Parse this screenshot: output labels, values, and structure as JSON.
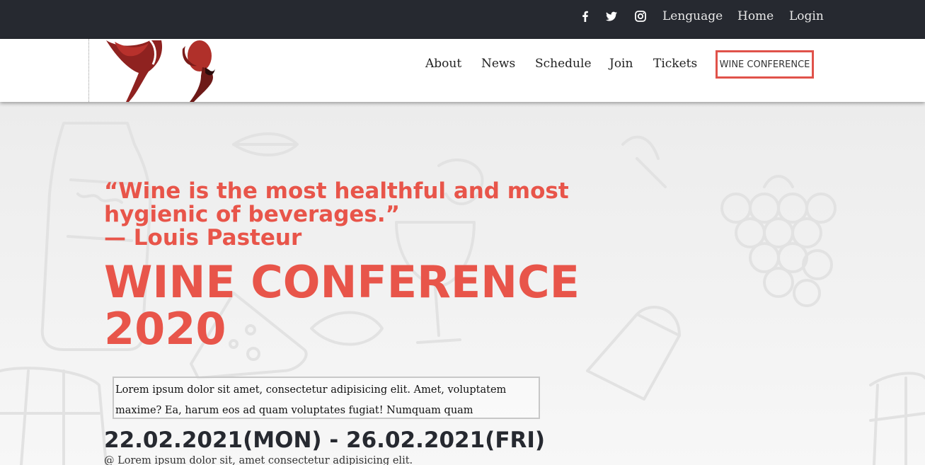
{
  "topbar": {
    "social_icons": [
      "facebook-icon",
      "twitter-icon",
      "instagram-icon"
    ],
    "links": {
      "language": "Lenguage",
      "home": "Home",
      "login": "Login"
    },
    "background_color": "#262930"
  },
  "nav": {
    "items": [
      "About",
      "News",
      "Schedule",
      "Join",
      "Tickets"
    ],
    "cta_label": "WINE CONFERENCE",
    "accent_color": "#e0524a"
  },
  "hero": {
    "quote_line1": "“Wine is the most healthful and most hygienic of beverages.”",
    "quote_author": "— Louis Pasteur",
    "title_line1": "WINE CONFERENCE",
    "title_line2": "2020",
    "description": "Lorem ipsum dolor sit amet, consectetur adipisicing elit. Amet, voluptatem maxime? Ea, harum eos ad quam voluptates fugiat! Numquam quam",
    "dates": "22.02.2021(MON) - 26.02.2021(FRI)",
    "venue": "@ Lorem ipsum dolor sit, amet consectetur adipisicing elit.",
    "accent_color": "#e8554a"
  }
}
